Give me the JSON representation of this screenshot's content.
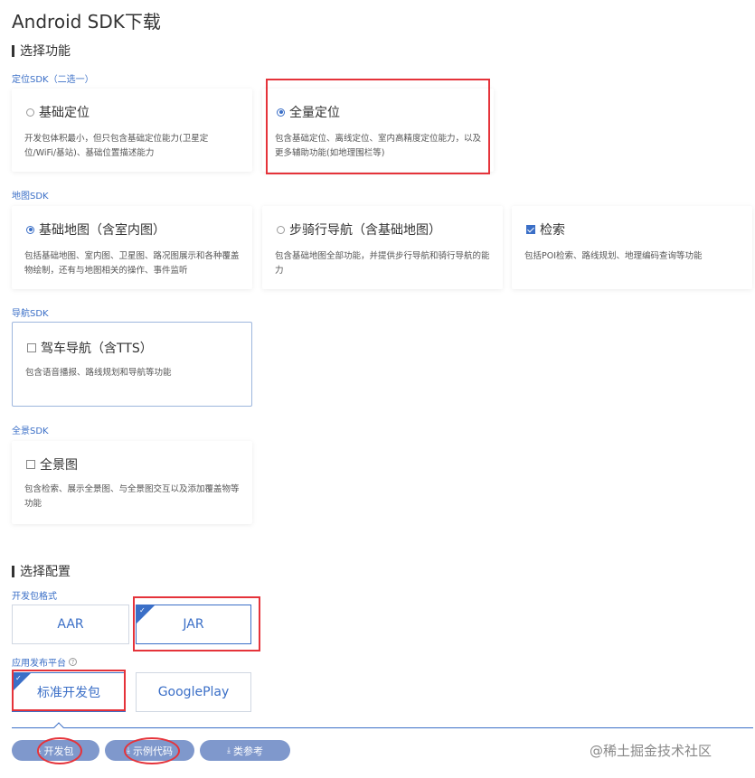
{
  "page": {
    "title": "Android SDK下载"
  },
  "sections": {
    "features": "选择功能",
    "config": "选择配置"
  },
  "groups": {
    "location": "定位SDK（二选一）",
    "map": "地图SDK",
    "nav": "导航SDK",
    "pano": "全景SDK"
  },
  "cards": {
    "loc_basic": {
      "title": "基础定位",
      "desc": "开发包体积最小，但只包含基础定位能力(卫星定位/WiFi/基站)、基础位置描述能力"
    },
    "loc_full": {
      "title": "全量定位",
      "desc": "包含基础定位、离线定位、室内高精度定位能力，以及更多辅助功能(如地理围栏等)"
    },
    "map_basic": {
      "title": "基础地图（含室内图）",
      "desc": "包括基础地图、室内图、卫星图、路况图展示和各种覆盖物绘制，还有与地图相关的操作、事件监听"
    },
    "map_walk": {
      "title": "步骑行导航（含基础地图）",
      "desc": "包含基础地图全部功能，并提供步行导航和骑行导航的能力"
    },
    "search": {
      "title": "检索",
      "desc": "包括POI检索、路线规划、地理编码查询等功能"
    },
    "nav_drive": {
      "title": "驾车导航（含TTS）",
      "desc": "包含语音播报、路线规划和导航等功能"
    },
    "pano": {
      "title": "全景图",
      "desc": "包含检索、展示全景图、与全景图交互以及添加覆盖物等功能"
    }
  },
  "config": {
    "format_label": "开发包格式",
    "format_options": [
      "AAR",
      "JAR"
    ],
    "platform_label": "应用发布平台",
    "platform_options": [
      "标准开发包",
      "GooglePlay"
    ]
  },
  "downloads": {
    "dev_pkg": "开发包",
    "sample_code": "示例代码",
    "class_ref": "类参考"
  },
  "watermark": "@稀土掘金技术社区",
  "colors": {
    "accent": "#3b6fc7",
    "button": "#7f98cc",
    "annotation": "#e5333a"
  }
}
